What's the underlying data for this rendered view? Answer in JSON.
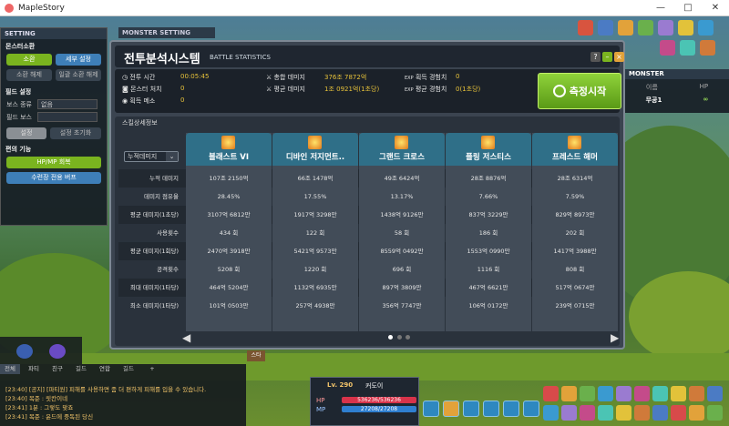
{
  "window": {
    "app_title": "MapleStory",
    "min": "—",
    "max": "□",
    "close": "✕"
  },
  "setting_panel": {
    "title": "SETTING",
    "sec_monster": "몬스터소환",
    "btn_summon": "소환",
    "btn_detail": "세부 설정",
    "btn_release": "소환 해제",
    "btn_release_all": "일괄 소환 해제",
    "sec_field": "필드 설정",
    "boss_type_label": "보스 종류",
    "boss_type_value": "없음",
    "field_boss_label": "필드 보스",
    "btn_apply": "설정",
    "btn_reset": "설정 초기화",
    "sec_convenience": "편의 기능",
    "btn_hpmp": "HP/MP 회복",
    "btn_move": "수련장 전용 버프"
  },
  "monster_setting": {
    "title": "MONSTER SETTING"
  },
  "monster_panel": {
    "title": "MONSTER",
    "col_name": "이름",
    "col_hp": "HP",
    "name": "무공1",
    "hp": "∞"
  },
  "battle": {
    "title": "전투분석시스템",
    "subtitle": "BATTLE STATISTICS",
    "battle_time_label": "전투 시간",
    "battle_time_value": "00:05:45",
    "monster_killed_label": "몬스터 처치",
    "monster_killed_value": "0",
    "gain_meso_label": "획득 메소",
    "gain_meso_value": "0",
    "total_damage_label": "총합 데미지",
    "total_damage_value": "376조 7872억",
    "avg_damage_label": "평균 데미지",
    "avg_damage_value": "1조 0921억(1초당)",
    "exp_gain_label": "획득 경험치",
    "exp_gain_value": "0",
    "exp_avg_label": "평균 경험치",
    "exp_avg_value": "0(1초당)",
    "exp_tag": "EXP",
    "measure_button": "측정시작",
    "skill_section": "스킬상세정보",
    "sort_dropdown": "누적데미지",
    "row_labels": [
      "누적 데미지",
      "데미지 점유율",
      "평균 데미지(1초당)",
      "사용횟수",
      "평균 데미지(1회당)",
      "공격횟수",
      "최대 데미지(1타당)",
      "최소 데미지(1타당)"
    ],
    "skills": [
      {
        "name": "블래스트 VI",
        "values": [
          "107조 2150억",
          "28.45%",
          "3107억 6812만",
          "434 회",
          "2470억 3918만",
          "5208 회",
          "464억 5204만",
          "101억 0503만"
        ]
      },
      {
        "name": "디바인 저지먼트..",
        "values": [
          "66조 1478억",
          "17.55%",
          "1917억 3298만",
          "122 회",
          "5421억 9573만",
          "1220 회",
          "1132억 6935만",
          "257억 4938만"
        ]
      },
      {
        "name": "그랜드 크로스",
        "values": [
          "49조 6424억",
          "13.17%",
          "1438억 9126만",
          "58 회",
          "8559억 0492만",
          "696 회",
          "897억 3809만",
          "356억 7747만"
        ]
      },
      {
        "name": "플링 저스티스",
        "values": [
          "28조 8876억",
          "7.66%",
          "837억 3229만",
          "186 회",
          "1553억 0990만",
          "1116 회",
          "467억 6621만",
          "106억 0172만"
        ]
      },
      {
        "name": "프레스드 해머",
        "values": [
          "28조 6314억",
          "7.59%",
          "829억 8973만",
          "202 회",
          "1417억 3988만",
          "808 회",
          "517억 0674만",
          "239억 0715만"
        ]
      }
    ],
    "prev": "◀",
    "next": "▶"
  },
  "chat": {
    "tabs": [
      "전체",
      "파티",
      "친구",
      "길드",
      "연합",
      "길드",
      "+"
    ],
    "lines": [
      "[23:40] [공지] [파티원] 피해를 사용하면 좀 더 편하게 피해를 입을 수 있습니다.",
      "[23:40] 목준 : 릿칸이네",
      "[23:41] 1분 : 그렇도 맞죠",
      "[23:41] 목준 : 윤드에 중독된 당신"
    ]
  },
  "status": {
    "level": "Lv. 290",
    "name": "커도이",
    "hp_label": "HP",
    "mp_label": "MP",
    "hp_value": "536236/536236",
    "mp_value": "27208/27208"
  },
  "sign": "스타",
  "colors": {
    "accent_green": "#7ab41f",
    "header_teal": "#2f6f88",
    "value_yellow": "#e7c23a"
  }
}
